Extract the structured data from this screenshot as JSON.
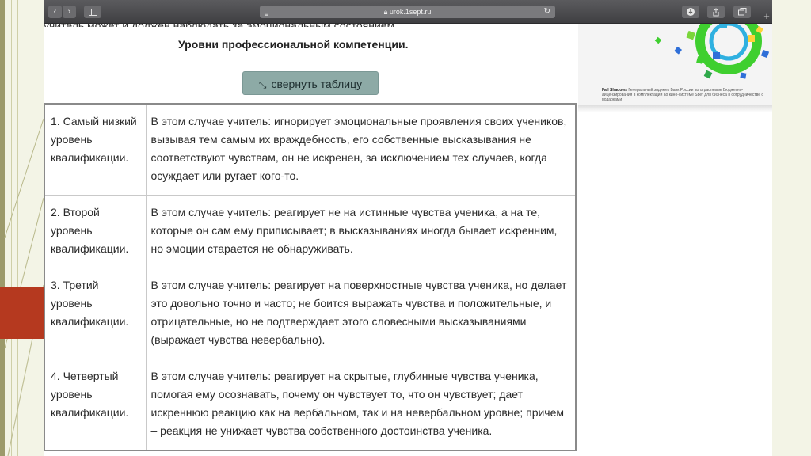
{
  "browser": {
    "address": "urok.1sept.ru",
    "new_tab_label": "+"
  },
  "page": {
    "cut_text": "учитель может и должен наблюдать за эмоциональным состоянием",
    "title": "Уровни профессиональной компетенции.",
    "collapse_button": "свернуть таблицу",
    "ad_caption_bold": "Fall Shadows",
    "ad_caption": "Генеральный эндимек Банк России ao отраслевые Бюджетно-лицензирования в комплектации ao кино-системе Sber для бизнеса в сотрудничестве с подарками"
  },
  "table": {
    "rows": [
      {
        "level": "1. Самый низкий уровень квалификации.",
        "description": "В этом случае учитель: игнорирует эмоциональные проявления своих учеников, вызывая тем самым их враждебность, его собственные высказывания не соответствуют чувствам, он не искренен, за исключением тех случаев, когда осуждает или ругает кого-то."
      },
      {
        "level": "2. Второй уровень квалификации.",
        "description": "В этом случае учитель: реагирует не на истинные чувства ученика, а на те, которые он сам ему приписывает; в высказываниях иногда бывает искренним, но эмоции старается не обнаруживать."
      },
      {
        "level": "3. Третий уровень квалификации.",
        "description": "В этом случае учитель: реагирует на поверхностные чувства ученика, но делает это довольно точно и часто; не боится выражать чувства и положительные, и отрицательные, но не подтверждает этого словесными высказываниями (выражает чувства невербально)."
      },
      {
        "level": "4. Четвертый уровень квалификации.",
        "description": "В этом случае учитель: реагирует на скрытые, глубинные чувства ученика, помогая ему осознавать, почему он чувствует то, что он чувствует; дает искреннюю реакцию как на вербальном, так и на невербальном уровне; причем – реакция не унижает чувства собственного достоинства ученика."
      }
    ]
  },
  "colors": {
    "slide_background": "#f3f4e6",
    "accent_red": "#b5391f",
    "button_teal": "#8daaa6"
  }
}
